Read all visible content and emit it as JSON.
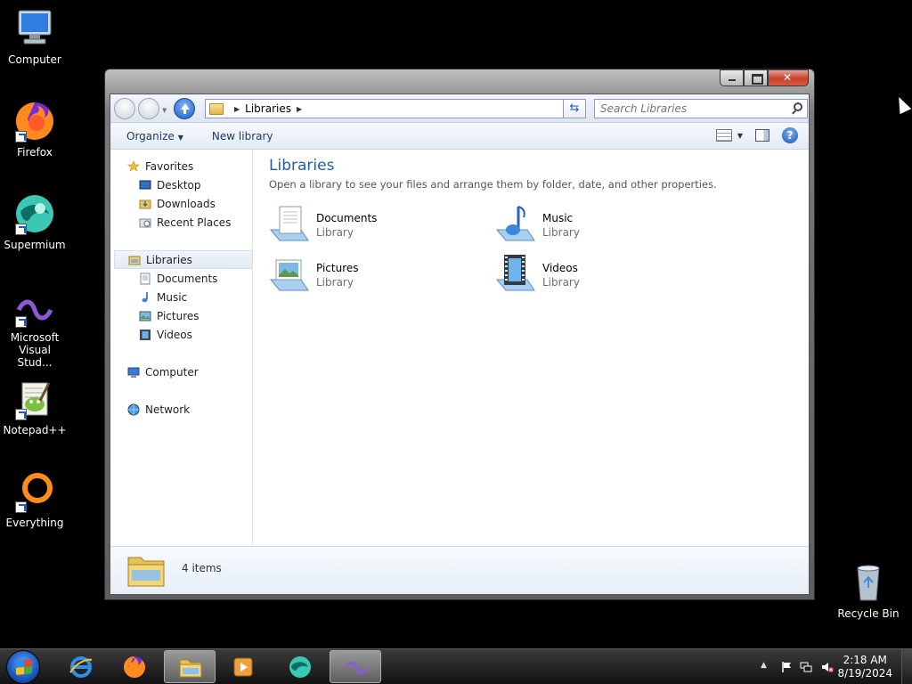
{
  "desktop": {
    "icons": [
      {
        "label": "Computer",
        "icon": "computer-icon"
      },
      {
        "label": "Firefox",
        "icon": "firefox-icon"
      },
      {
        "label": "Supermium",
        "icon": "supermium-icon"
      },
      {
        "label": "Microsoft Visual Stud...",
        "icon": "visual-studio-icon"
      },
      {
        "label": "Notepad++",
        "icon": "notepadpp-icon"
      },
      {
        "label": "Everything",
        "icon": "everything-icon"
      },
      {
        "label": "Recycle Bin",
        "icon": "recycle-bin-icon"
      }
    ]
  },
  "window": {
    "address": {
      "path": "Libraries"
    },
    "search": {
      "placeholder": "Search Libraries"
    },
    "toolbar": {
      "organize": "Organize",
      "new_library": "New library"
    },
    "nav": {
      "favorites": "Favorites",
      "desktop": "Desktop",
      "downloads": "Downloads",
      "recent_places": "Recent Places",
      "libraries": "Libraries",
      "documents": "Documents",
      "music": "Music",
      "pictures": "Pictures",
      "videos": "Videos",
      "computer": "Computer",
      "network": "Network"
    },
    "content": {
      "title": "Libraries",
      "subtitle": "Open a library to see your files and arrange them by folder, date, and other properties.",
      "libraries": [
        {
          "name": "Documents",
          "type": "Library"
        },
        {
          "name": "Music",
          "type": "Library"
        },
        {
          "name": "Pictures",
          "type": "Library"
        },
        {
          "name": "Videos",
          "type": "Library"
        }
      ]
    },
    "details": {
      "count": "4 items"
    }
  },
  "taskbar": {
    "clock": {
      "time": "2:18 AM",
      "date": "8/19/2024"
    }
  },
  "colors": {
    "accent": "#1e5eaa",
    "taskbar": "#1f1f1f"
  }
}
